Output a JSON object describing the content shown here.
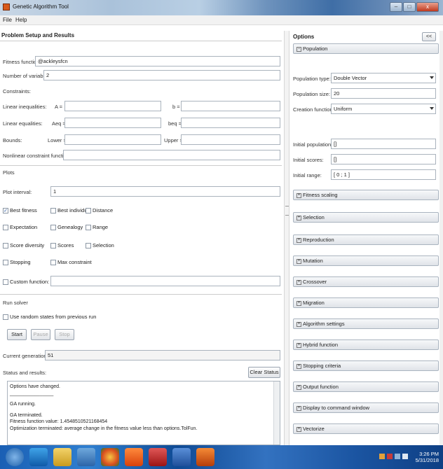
{
  "window": {
    "title": "Genetic Algorithm Tool",
    "minimize": "–",
    "maximize": "□",
    "close": "x"
  },
  "menu": {
    "file": "File",
    "help": "Help"
  },
  "left": {
    "title": "Problem Setup and Results",
    "fitness_label": "Fitness function:",
    "fitness_value": "@ackleysfcn",
    "nvars_label": "Number of variables:",
    "nvars_value": "2",
    "constraints_title": "Constraints:",
    "lin_ineq_label": "Linear inequalities:",
    "A_label": "A =",
    "b_label": "b =",
    "lin_eq_label": "Linear equalities:",
    "Aeq_label": "Aeq =",
    "beq_label": "beq =",
    "bounds_label": "Bounds:",
    "lower_label": "Lower =",
    "upper_label": "Upper =",
    "nonlin_label": "Nonlinear constraint function:",
    "plots_title": "Plots",
    "plot_interval_label": "Plot interval:",
    "plot_interval_value": "1",
    "plots": {
      "best_fitness": "Best fitness",
      "best_individual": "Best individual",
      "distance": "Distance",
      "expectation": "Expectation",
      "genealogy": "Genealogy",
      "range": "Range",
      "score_diversity": "Score diversity",
      "scores": "Scores",
      "selection": "Selection",
      "stopping": "Stopping",
      "max_constraint": "Max constraint",
      "custom_function": "Custom function:"
    },
    "best_fitness_check": "✓",
    "run_title": "Run solver",
    "random_states_label": "Use random states from previous run",
    "start": "Start",
    "pause": "Pause",
    "stop": "Stop",
    "current_gen_label": "Current generation:",
    "current_gen_value": "51",
    "status_label": "Status and results:",
    "clear_status": "Clear Status",
    "status_lines": [
      "Options have changed.",
      "________________",
      "",
      "GA running.",
      "",
      "GA terminated.",
      "Fitness function value: 1.4548510521168454",
      "Optimization terminated: average change in the fitness value less than options.TolFun."
    ]
  },
  "right": {
    "title": "Options",
    "collapse_btn": "<<",
    "population_head": "Population",
    "pop_type_label": "Population type:",
    "pop_type_value": "Double Vector",
    "pop_size_label": "Population size:",
    "pop_size_value": "20",
    "creation_label": "Creation function:",
    "creation_value": "Uniform",
    "init_pop_label": "Initial population:",
    "init_pop_value": "[]",
    "init_scores_label": "Initial scores:",
    "init_scores_value": "[]",
    "init_range_label": "Initial range:",
    "init_range_value": "[ 0 ; 1 ]",
    "sections": [
      "Fitness scaling",
      "Selection",
      "Reproduction",
      "Mutation",
      "Crossover",
      "Migration",
      "Algorithm settings",
      "Hybrid function",
      "Stopping criteria",
      "Output function",
      "Display to command window",
      "Vectorize"
    ],
    "plus_glyph": "+",
    "minus_glyph": "−"
  },
  "taskbar": {
    "time": "3:26 PM",
    "date": "5/31/2018"
  }
}
